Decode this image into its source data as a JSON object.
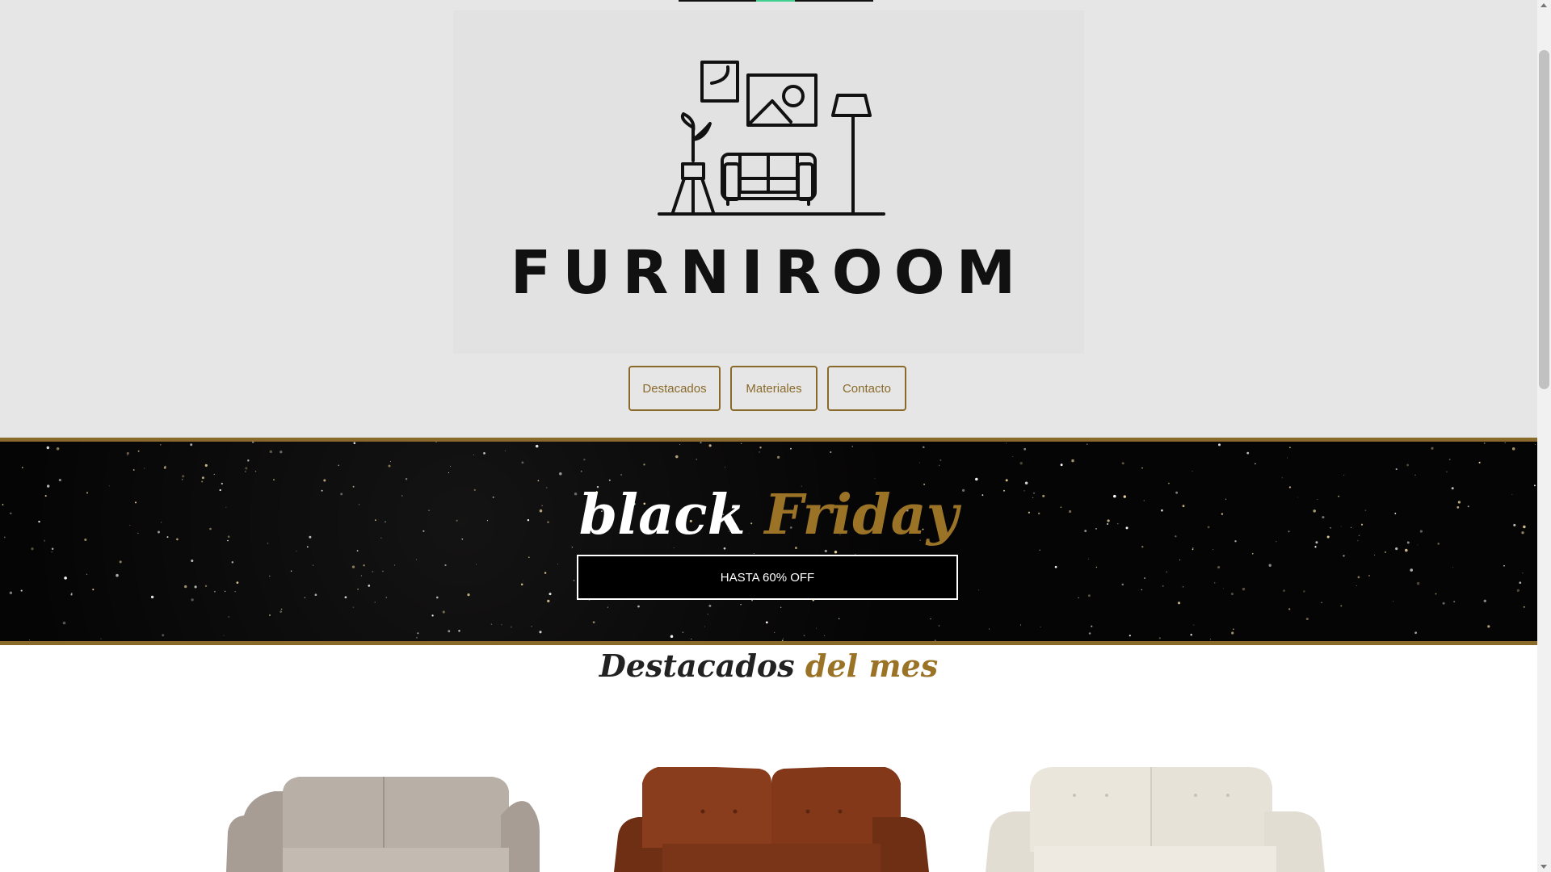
{
  "header": {
    "logo": {
      "brand_name": "FURNIROOM",
      "icon": "living-room-icon"
    },
    "nav": {
      "items": [
        {
          "label": "Destacados"
        },
        {
          "label": "Materiales"
        },
        {
          "label": "Contacto"
        }
      ]
    }
  },
  "banner": {
    "title_part1": "black",
    "title_part2": "Friday",
    "offer_label": "HASTA 60% OFF"
  },
  "featured": {
    "title_part1": "Destacados",
    "title_part2": "del mes",
    "products": [
      {
        "image": "grey-fabric-sofa-image"
      },
      {
        "image": "brown-leather-sofa-image"
      },
      {
        "image": "white-leather-sofa-image"
      }
    ]
  },
  "colors": {
    "accent_gold": "#8a6a2a",
    "header_bg": "#e6e6e6",
    "banner_bg": "#060505"
  }
}
